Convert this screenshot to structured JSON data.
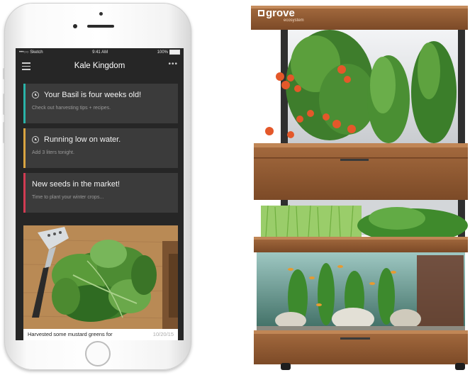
{
  "status_bar": {
    "carrier": "•••○○ Sketch",
    "time": "9:41 AM",
    "battery": "100%"
  },
  "app": {
    "title": "Kale Kingdom",
    "more": "•••"
  },
  "cards": [
    {
      "title": "Your Basil is four weeks old!",
      "subtitle": "Check out harvesting tips + recipes.",
      "accent": "#2ab3a8",
      "icon": "clock-icon"
    },
    {
      "title": "Running low on water.",
      "subtitle": "Add 3 liters tonight.",
      "accent": "#d9a441",
      "icon": "clock-icon"
    },
    {
      "title": "New seeds in the market!",
      "subtitle": "Time to plant your winter crops...",
      "accent": "#d23b53",
      "icon": ""
    }
  ],
  "photo_post": {
    "caption": "Harvested some mustard greens for",
    "date": "10/20/15"
  },
  "brand": {
    "logo_text": "grove",
    "sub_text": "ecosystem"
  }
}
